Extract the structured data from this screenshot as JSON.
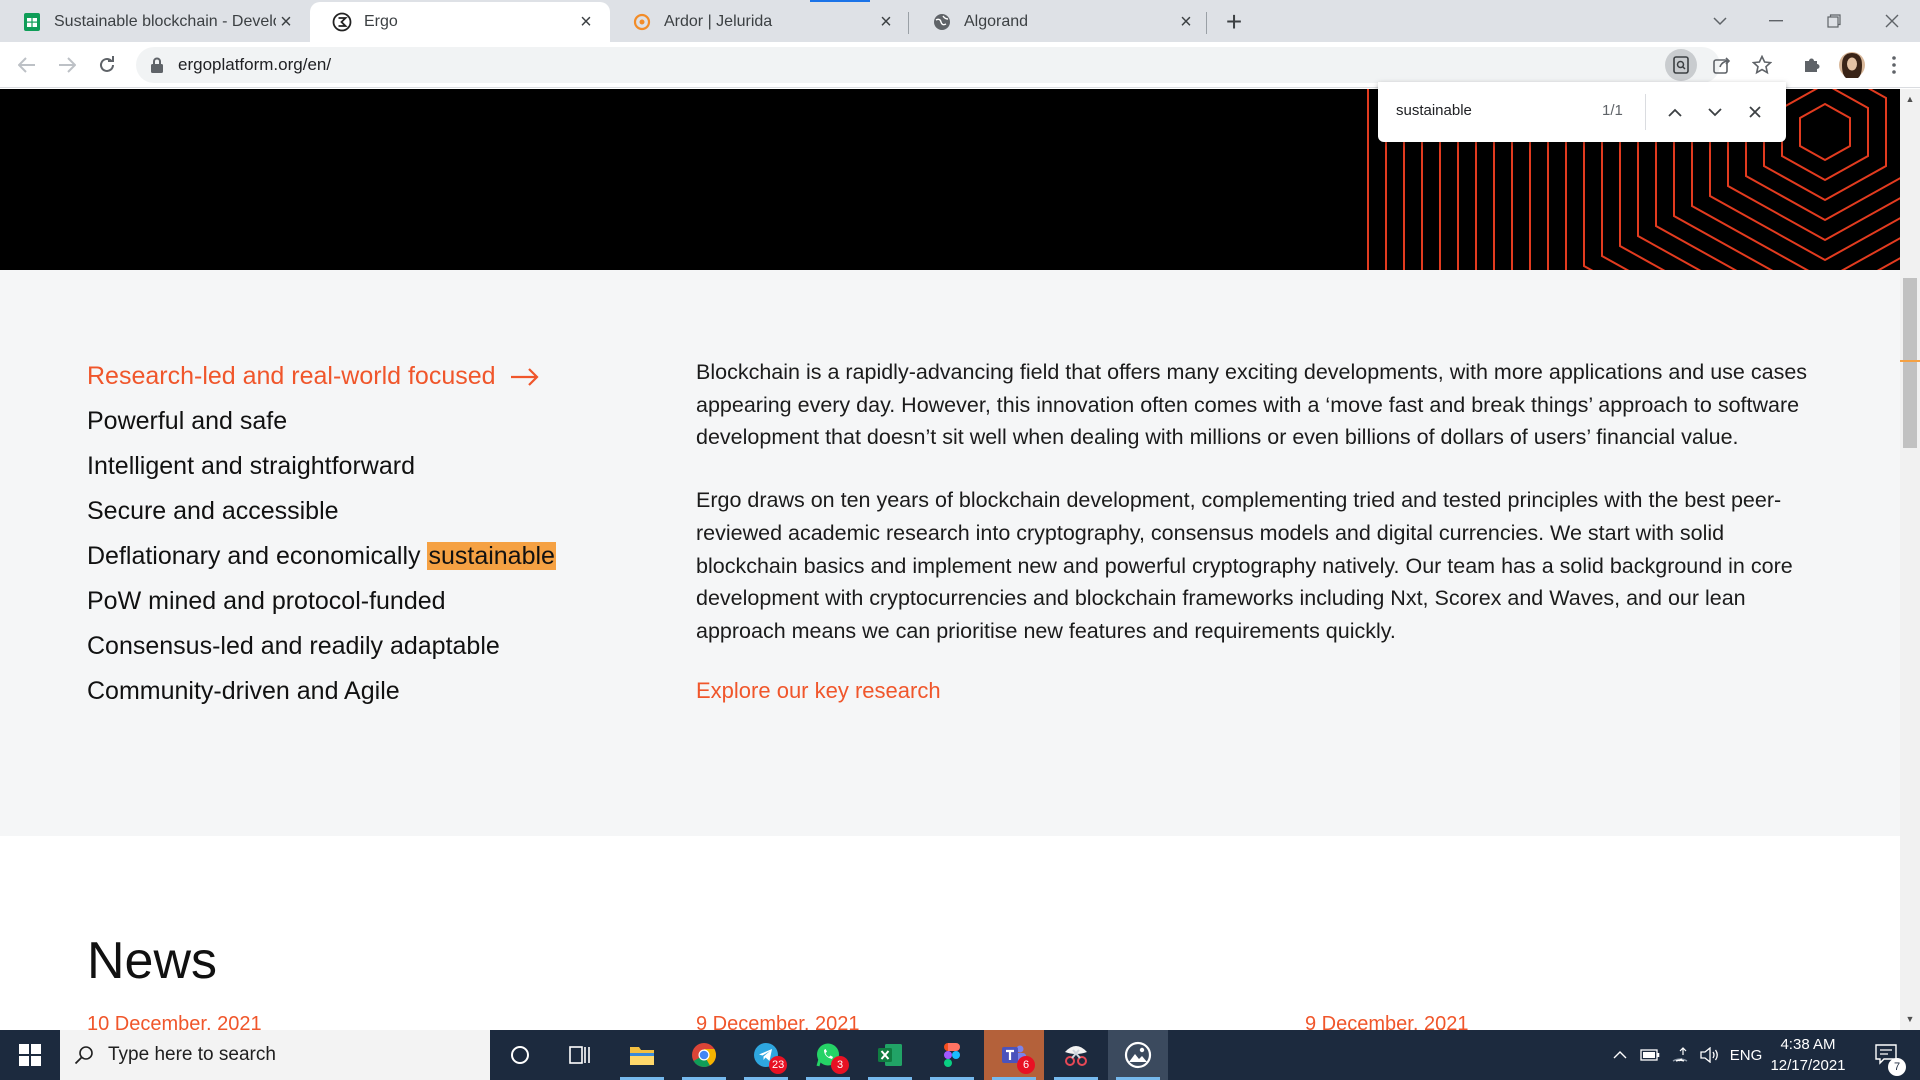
{
  "browser": {
    "tabs": [
      {
        "title": "Sustainable blockchain - Develop",
        "icon": "sheets-icon",
        "active": false
      },
      {
        "title": "Ergo",
        "icon": "ergo-icon",
        "active": true
      },
      {
        "title": "Ardor | Jelurida",
        "icon": "ardor-icon",
        "active": false
      },
      {
        "title": "Algorand",
        "icon": "globe-icon",
        "active": false
      }
    ],
    "url": "ergoplatform.org/en/"
  },
  "find_bar": {
    "query": "sustainable",
    "count": "1/1"
  },
  "features": {
    "items": [
      "Research-led and real-world focused",
      "Powerful and safe",
      "Intelligent and straightforward",
      "Secure and accessible",
      "Deflationary and economically",
      "PoW mined and protocol-funded",
      "Consensus-led and readily adaptable",
      "Community-driven and Agile"
    ],
    "highlight_word": "sustainable",
    "paragraph1": "Blockchain is a rapidly-advancing field that offers many exciting developments, with more applications and use cases appearing every day. However, this innovation often comes with a ‘move fast and break things’ approach to software development that doesn’t sit well when dealing with millions or even billions of dollars of users’ financial value.",
    "paragraph2": "Ergo draws on ten years of blockchain development, complementing tried and tested principles with the best peer-reviewed academic research into cryptography, consensus models and digital currencies. We start with solid blockchain basics and implement new and powerful cryptography natively. Our team has a solid background in core development with cryptocurrencies and blockchain frameworks including Nxt, Scorex and Waves, and our lean approach means we can prioritise new features and requirements quickly.",
    "explore_link": "Explore our key research"
  },
  "news": {
    "title": "News",
    "dates": [
      "10 December, 2021",
      "9 December, 2021",
      "9 December, 2021"
    ]
  },
  "taskbar": {
    "search_placeholder": "Type here to search",
    "telegram_badge": "23",
    "whatsapp_badge": "3",
    "teams_badge": "6",
    "language": "ENG",
    "time": "4:38 AM",
    "date": "12/17/2021",
    "notifications": "7"
  },
  "colors": {
    "accent": "#f0562b",
    "highlight": "#f5a143",
    "hero_bg": "#000000",
    "section_bg": "#f5f6f7",
    "taskbar_bg": "#1c2a3e"
  }
}
